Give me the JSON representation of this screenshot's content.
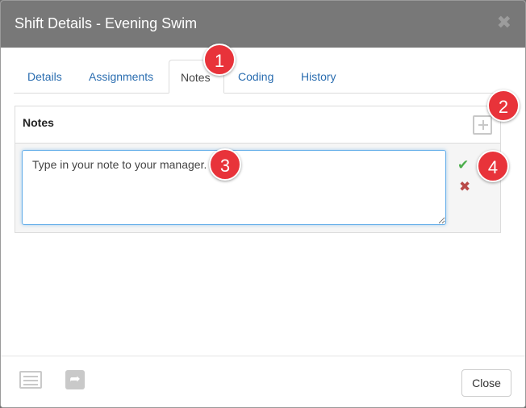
{
  "dialog": {
    "title": "Shift Details - Evening Swim",
    "close_symbol": "✖"
  },
  "tabs": [
    {
      "label": "Details",
      "active": false
    },
    {
      "label": "Assignments",
      "active": false
    },
    {
      "label": "Notes",
      "active": true
    },
    {
      "label": "Coding",
      "active": false
    },
    {
      "label": "History",
      "active": false
    }
  ],
  "notes_panel": {
    "title": "Notes",
    "input_value": "Type in your note to your manager.",
    "save_symbol": "✔",
    "cancel_symbol": "✖"
  },
  "footer": {
    "share_symbol": "➦",
    "close_label": "Close"
  },
  "callouts": [
    "1",
    "2",
    "3",
    "4"
  ],
  "colors": {
    "header_bg": "#787878",
    "link": "#2a6db0",
    "save": "#4cae4c",
    "cancel": "#b94a48",
    "callout": "#e8333a"
  }
}
